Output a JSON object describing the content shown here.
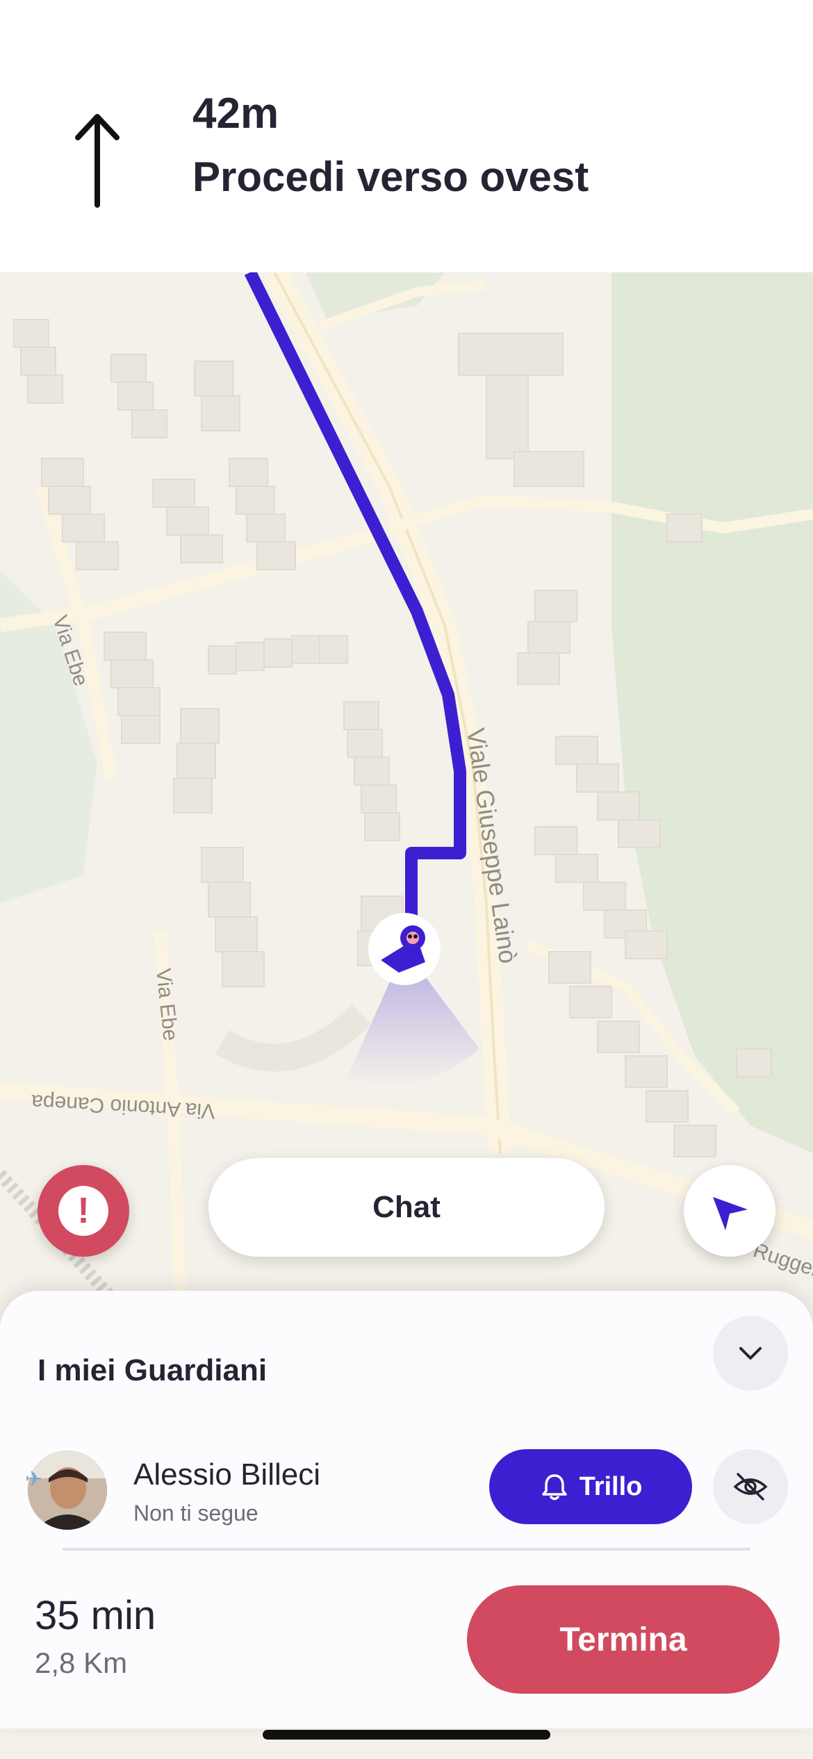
{
  "navigation": {
    "distance": "42m",
    "instruction": "Procedi verso ovest",
    "direction_icon": "arrow-up-icon"
  },
  "map": {
    "street_labels": [
      "Via Ebe",
      "Via Ebe",
      "Viale Giuseppe Lainò",
      "Via Antonio Canepa",
      "Ruggero"
    ],
    "route_color": "#3d1fd2",
    "user_marker_icon": "owl-mascot-icon"
  },
  "controls": {
    "sos_icon": "exclamation-icon",
    "chat_label": "Chat",
    "locate_icon": "navigation-arrow-icon"
  },
  "sheet": {
    "title": "I miei Guardiani",
    "collapse_icon": "chevron-down-icon",
    "guardians": [
      {
        "name": "Alessio Billeci",
        "status": "Non ti segue",
        "action_label": "Trillo",
        "action_icon": "bell-icon",
        "hide_icon": "eye-off-icon"
      }
    ],
    "eta": {
      "time": "35 min",
      "distance": "2,8 Km"
    },
    "end_label": "Termina"
  },
  "colors": {
    "accent": "#3d1fd2",
    "danger": "#d14a5f",
    "text": "#262433"
  }
}
